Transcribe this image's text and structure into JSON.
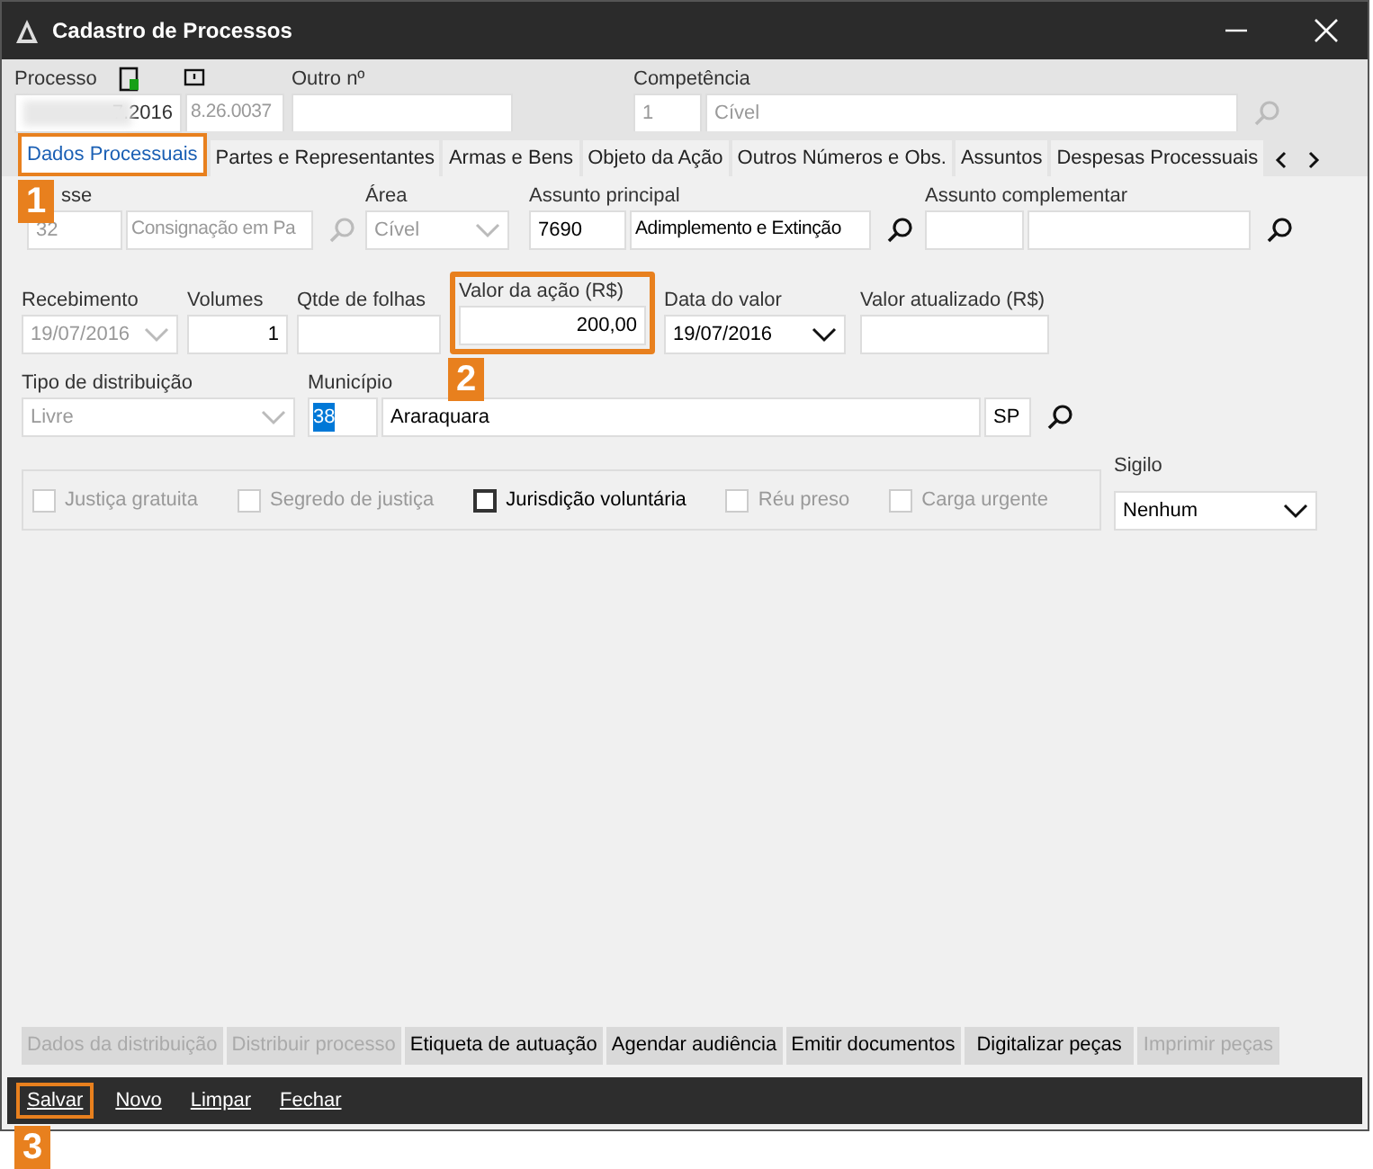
{
  "window": {
    "title": "Cadastro de Processos"
  },
  "header": {
    "processo": {
      "label": "Processo",
      "value": "7.2016",
      "suffix": "8.26.0037"
    },
    "outro": {
      "label": "Outro nº"
    },
    "competencia": {
      "label": "Competência",
      "code": "1",
      "value": "Cível"
    }
  },
  "tabs": [
    {
      "label": "Dados Processuais",
      "selected": true
    },
    {
      "label": "Partes e Representantes",
      "selected": false
    },
    {
      "label": "Armas e Bens",
      "selected": false
    },
    {
      "label": "Objeto da Ação",
      "selected": false
    },
    {
      "label": "Outros Números e Obs.",
      "selected": false
    },
    {
      "label": "Assuntos",
      "selected": false
    },
    {
      "label": "Despesas Processuais",
      "selected": false
    }
  ],
  "classe": {
    "label": "sse",
    "code": "32",
    "value": "Consignação em Pa"
  },
  "area": {
    "label": "Área",
    "value": "Cível"
  },
  "assunto_principal": {
    "label": "Assunto principal",
    "code": "7690",
    "value": "Adimplemento e Extinção"
  },
  "assunto_complementar": {
    "label": "Assunto complementar"
  },
  "recebimento": {
    "label": "Recebimento",
    "value": "19/07/2016"
  },
  "volumes": {
    "label": "Volumes",
    "value": "1"
  },
  "qtde_folhas": {
    "label": "Qtde de folhas"
  },
  "valor_acao": {
    "label": "Valor da ação (R$)",
    "value": "200,00"
  },
  "data_valor": {
    "label": "Data do valor",
    "value": "19/07/2016"
  },
  "valor_atualizado": {
    "label": "Valor atualizado (R$)"
  },
  "tipo_distribuicao": {
    "label": "Tipo de distribuição",
    "value": "Livre"
  },
  "municipio": {
    "label": "Município",
    "code": "38",
    "value": "Araraquara",
    "uf": "SP"
  },
  "options": [
    {
      "label": "Justiça gratuita",
      "checked": false,
      "disabled": true
    },
    {
      "label": "Segredo de justiça",
      "checked": false,
      "disabled": true
    },
    {
      "label": "Jurisdição voluntária",
      "checked": false,
      "disabled": false
    },
    {
      "label": "Réu preso",
      "checked": false,
      "disabled": true
    },
    {
      "label": "Carga urgente",
      "checked": false,
      "disabled": true
    }
  ],
  "sigilo": {
    "label": "Sigilo",
    "value": "Nenhum"
  },
  "action_buttons": [
    {
      "label": "Dados da distribuição",
      "disabled": true
    },
    {
      "label": "Distribuir processo",
      "disabled": true
    },
    {
      "label": "Etiqueta de autuação",
      "disabled": false
    },
    {
      "label": "Agendar audiência",
      "disabled": false
    },
    {
      "label": "Emitir documentos",
      "disabled": false
    },
    {
      "label": "Digitalizar peças",
      "disabled": false
    },
    {
      "label": "Imprimir peças",
      "disabled": true
    }
  ],
  "footer_buttons": [
    "Salvar",
    "Novo",
    "Limpar",
    "Fechar"
  ],
  "callouts": [
    "1",
    "2",
    "3"
  ]
}
